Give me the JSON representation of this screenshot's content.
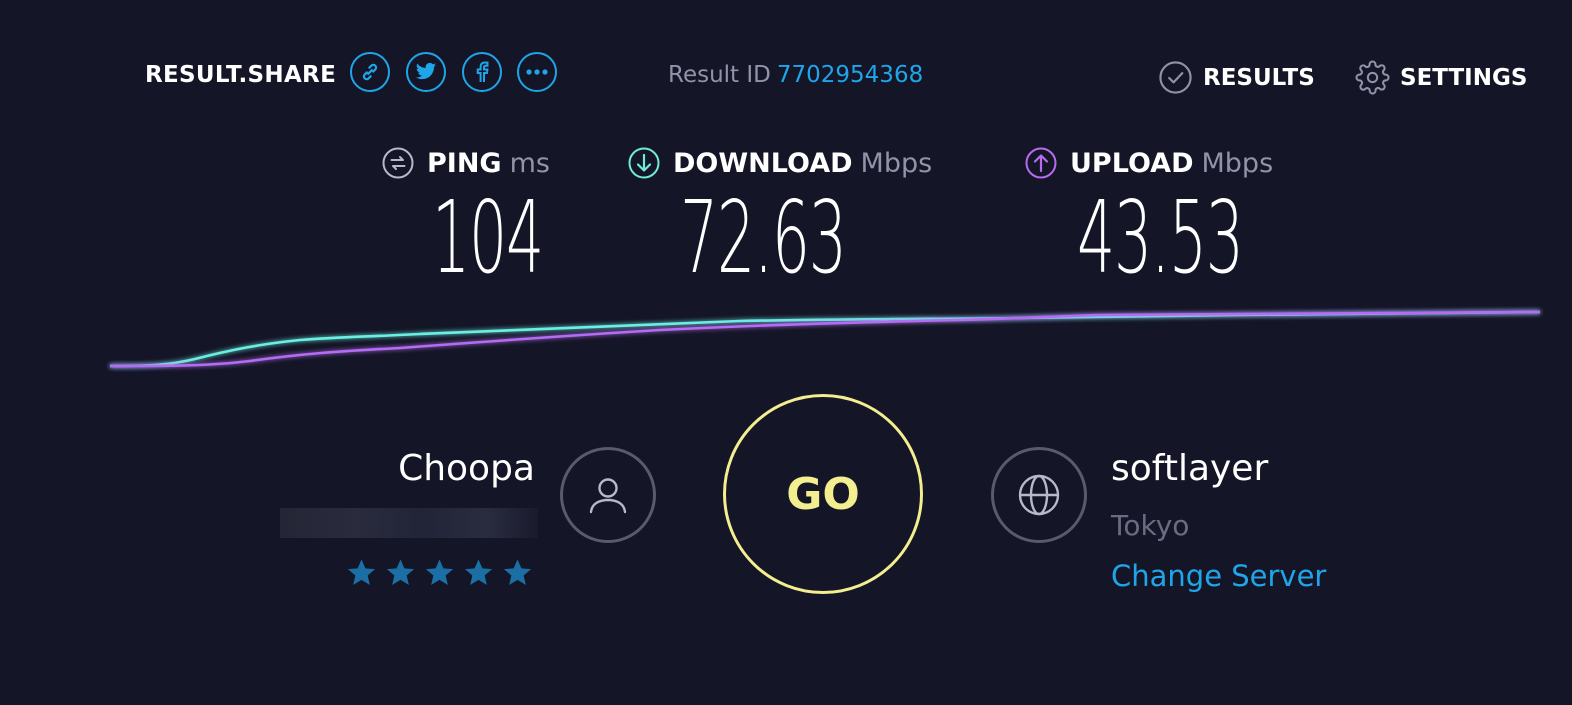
{
  "header": {
    "share_label": "RESULT.SHARE",
    "share_buttons": [
      {
        "name": "link-icon"
      },
      {
        "name": "twitter-icon"
      },
      {
        "name": "facebook-icon"
      },
      {
        "name": "more-icon"
      }
    ],
    "result_id_label": "Result ID",
    "result_id_value": "7702954368",
    "results_label": "RESULTS",
    "settings_label": "SETTINGS"
  },
  "metrics": {
    "ping": {
      "label": "PING",
      "unit": "ms",
      "value": "104",
      "color": "#b7b8c8"
    },
    "download": {
      "label": "DOWNLOAD",
      "unit": "Mbps",
      "value": "72.63",
      "color": "#6fecd9"
    },
    "upload": {
      "label": "UPLOAD",
      "unit": "Mbps",
      "value": "43.53",
      "color": "#b86bf0"
    }
  },
  "graph": {
    "download_color": "#6af0e3",
    "upload_color": "#b46cf2"
  },
  "isp": {
    "name": "Choopa",
    "rating_stars": 5,
    "star_color": "#1b6fa4"
  },
  "go_label": "GO",
  "server": {
    "name": "softlayer",
    "location": "Tokyo",
    "change_label": "Change Server"
  },
  "colors": {
    "background": "#141526",
    "accent": "#1fa5ea",
    "go": "#f3ee8f"
  }
}
